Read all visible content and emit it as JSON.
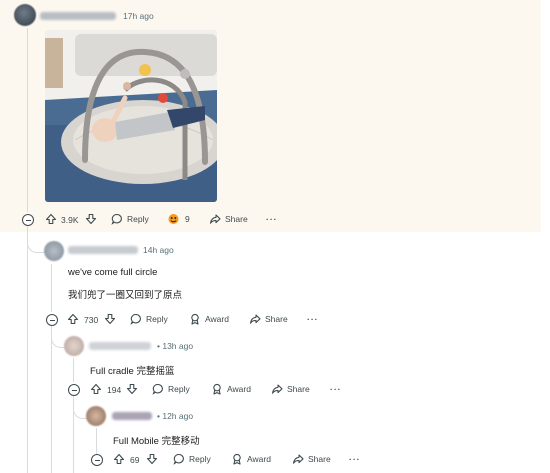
{
  "post": {
    "time": "17h ago",
    "image_alt": "baby play gym photo",
    "actions": {
      "votes": "3.9K",
      "reply": "Reply",
      "award_count": "9",
      "share": "Share",
      "more": "···"
    }
  },
  "comments": [
    {
      "time": "14h ago",
      "lines": [
        "we've come full circle",
        "我们兜了一圈又回到了原点"
      ],
      "actions": {
        "votes": "730",
        "reply": "Reply",
        "award": "Award",
        "share": "Share",
        "more": "···"
      }
    },
    {
      "time": "• 13h ago",
      "lines": [
        "Full cradle  完整摇篮"
      ],
      "actions": {
        "votes": "194",
        "reply": "Reply",
        "award": "Award",
        "share": "Share",
        "more": "···"
      }
    },
    {
      "time": "• 12h ago",
      "lines": [
        "Full Mobile  完整移动"
      ],
      "actions": {
        "votes": "69",
        "reply": "Reply",
        "award": "Award",
        "share": "Share",
        "more": "···"
      }
    }
  ],
  "colors": {
    "highlight_bg": "#fdf8ef",
    "thread_line": "#d8dcdf",
    "text_meta": "#576f76"
  }
}
